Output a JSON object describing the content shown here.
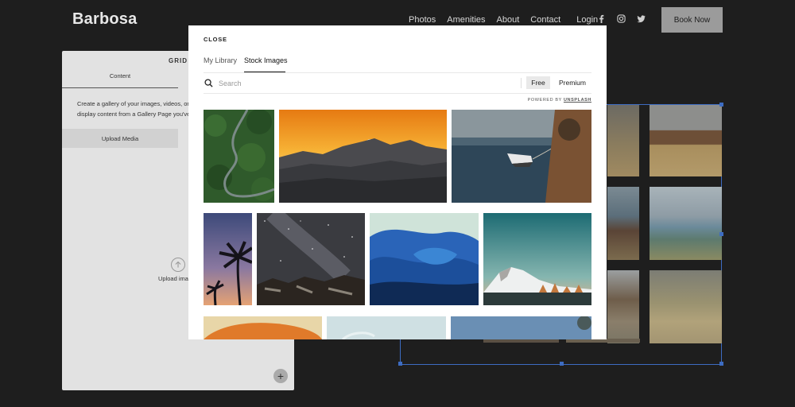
{
  "site": {
    "brand": "Barbosa",
    "nav": [
      "Photos",
      "Amenities",
      "About",
      "Contact"
    ],
    "login": "Login",
    "book_now": "Book Now",
    "social_icons": [
      "facebook-icon",
      "instagram-icon",
      "twitter-icon"
    ]
  },
  "panel": {
    "title": "GRID",
    "tab_content": "Content",
    "description": "Create a gallery of your images, videos, or display content from a Gallery Page you've",
    "upload_media": "Upload Media",
    "upload_images": "Upload ima",
    "add_icon": "+"
  },
  "modal": {
    "close": "CLOSE",
    "tabs": [
      "My Library",
      "Stock Images"
    ],
    "active_tab": "Stock Images",
    "search_placeholder": "Search",
    "filters": [
      "Free",
      "Premium"
    ],
    "active_filter": "Free",
    "powered_by": "POWERED BY",
    "powered_brand": "UNSPLASH",
    "images": [
      "forest-winding-road",
      "mountain-sunset",
      "boat-in-sea",
      "palm-tree-dusk",
      "milky-way-night",
      "blue-abstract-waves",
      "snowy-mountain",
      "orange-abstract",
      "pale-blue-abstract",
      "blue-sky-landscape"
    ]
  },
  "colors": {
    "background": "#1e1e1e",
    "selection": "#3d6cc2",
    "book_button": "#9b9b9b"
  }
}
